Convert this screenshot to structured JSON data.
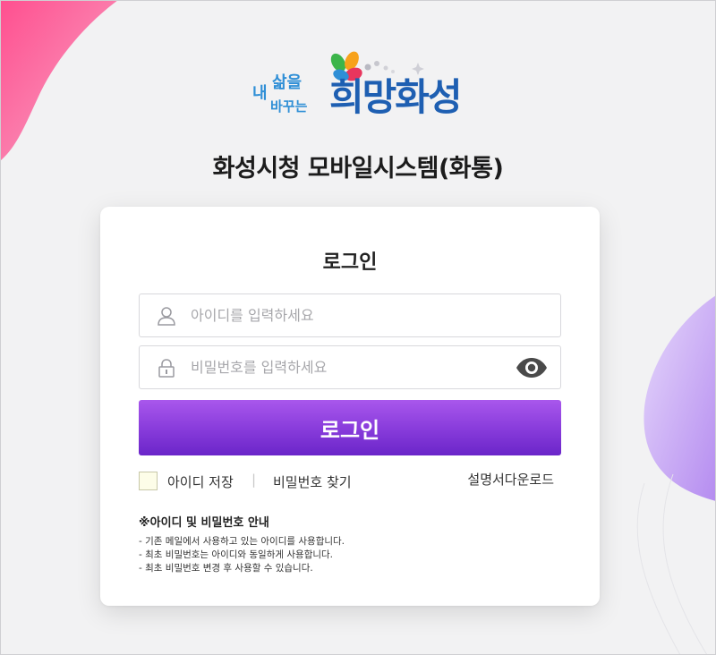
{
  "logo": {
    "small_line1": "내",
    "small_line2": "삶을",
    "small_line3": "바꾸는",
    "main": "희망화성"
  },
  "page": {
    "title": "화성시청 모바일시스템(화통)"
  },
  "login": {
    "title": "로그인",
    "id_placeholder": "아이디를 입력하세요",
    "pw_placeholder": "비밀번호를 입력하세요",
    "submit_label": "로그인",
    "save_id_label": "아이디 저장",
    "separator": "|",
    "find_pw_label": "비밀번호 찾기",
    "manual_download_label": "설명서다운로드"
  },
  "notice": {
    "title": "※아이디 및 비밀번호 안내",
    "lines": [
      "- 기존 메일에서 사용하고 있는 아이디를 사용합니다.",
      "- 최초 비밀번호는 아이디와 동일하게 사용합니다.",
      "- 최초 비밀번호 변경 후 사용할 수 있습니다."
    ]
  },
  "icons": {
    "id_field": "user-icon",
    "pw_field": "lock-icon",
    "toggle_pw": "eye-icon"
  },
  "colors": {
    "accent_start": "#a957ec",
    "accent_end": "#6a25c9",
    "deco_pink": "#f25c9a",
    "deco_purple": "#c9a8f5",
    "logo_blue": "#1e5fb2"
  }
}
